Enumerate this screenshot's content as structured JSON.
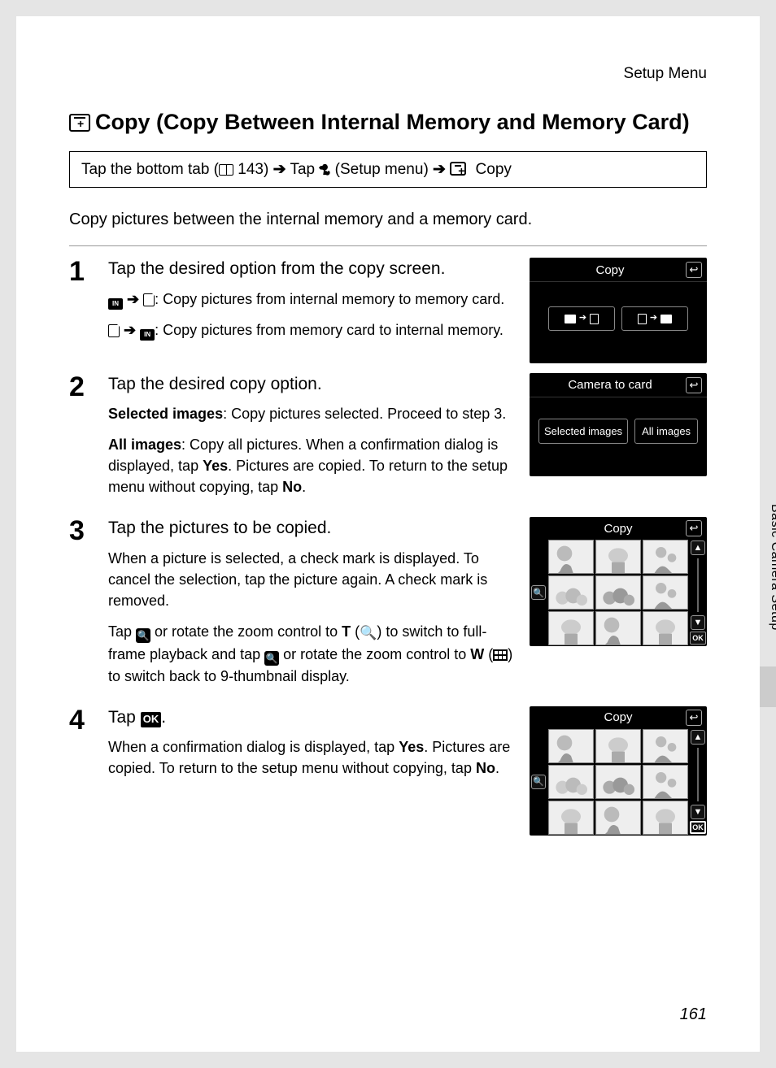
{
  "header": "Setup Menu",
  "title": "Copy (Copy Between Internal Memory and Memory Card)",
  "breadcrumb": {
    "pre": "Tap the bottom tab (",
    "pageref": "143",
    "mid1": ") ",
    "tap1": "Tap ",
    "setup": " (Setup menu) ",
    "tap2": " Copy"
  },
  "intro": "Copy pictures between the internal memory and a memory card.",
  "steps": {
    "s1": {
      "num": "1",
      "title": "Tap the desired option from the copy screen.",
      "p1": ": Copy pictures from internal memory to memory card.",
      "p2": ": Copy pictures from memory card to internal memory."
    },
    "s2": {
      "num": "2",
      "title": "Tap the desired copy option.",
      "p1a": "Selected images",
      "p1b": ": Copy pictures selected. Proceed to step 3.",
      "p2a": "All images",
      "p2b": ": Copy all pictures. When a confirmation dialog is displayed, tap ",
      "p2c": "Yes",
      "p2d": ". Pictures are copied. To return to the setup menu without copying, tap ",
      "p2e": "No",
      "p2f": "."
    },
    "s3": {
      "num": "3",
      "title": "Tap the pictures to be copied.",
      "p1": "When a picture is selected, a check mark is displayed. To cancel the selection, tap the picture again. A check mark is removed.",
      "p2a": "Tap ",
      "p2b": " or rotate the zoom control to ",
      "p2c": "T",
      "p2d": " (",
      "p2e": ") to switch to full-frame playback and tap ",
      "p2f": " or rotate the zoom control to ",
      "p2g": "W",
      "p2h": " (",
      "p2i": ") to switch back to 9-thumbnail display."
    },
    "s4": {
      "num": "4",
      "title_pre": "Tap ",
      "title_icon": "OK",
      "title_post": ".",
      "p1a": "When a confirmation dialog is displayed, tap ",
      "p1b": "Yes",
      "p1c": ". Pictures are copied. To return to the setup menu without copying, tap ",
      "p1d": "No",
      "p1e": "."
    }
  },
  "screens": {
    "s1": {
      "title": "Copy"
    },
    "s2": {
      "title": "Camera to card",
      "opt1": "Selected images",
      "opt2": "All images"
    },
    "s3": {
      "title": "Copy",
      "ok": "OK"
    },
    "s4": {
      "title": "Copy",
      "ok": "OK"
    }
  },
  "side_tab": "Basic Camera Setup",
  "page_number": "161"
}
